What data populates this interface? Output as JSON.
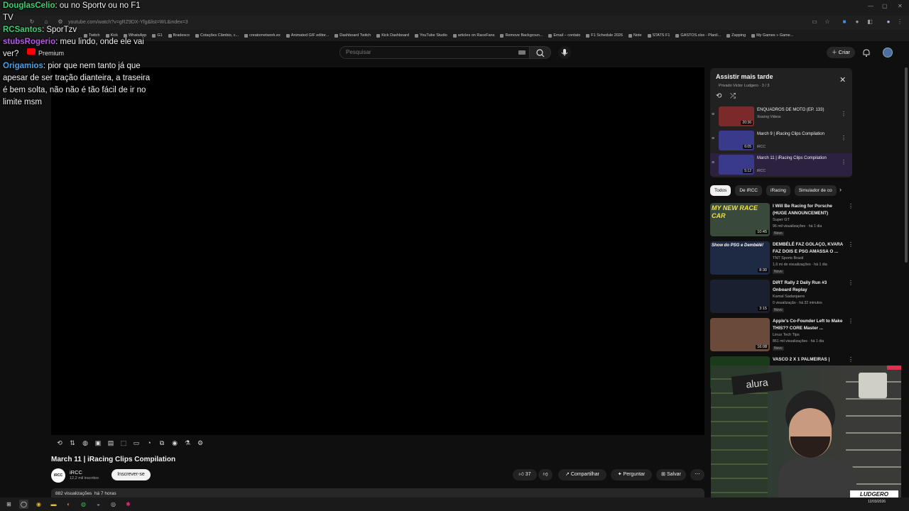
{
  "browser": {
    "url": "youtube.com/watch?v=gRZ9DX-Yfg&list=WL&index=3",
    "bookmarks": [
      "Twitch",
      "Kick",
      "WhatsApp",
      "G1",
      "Bradesco",
      "Cotações Câmbio, c...",
      "creatornetwork.ex",
      "Animated GIF editor...",
      "Dashboard Twitch",
      "Kick Dashboard",
      "YouTube Studio",
      "articles on RaceFans",
      "Remove Backgroun...",
      "Email – contato",
      "F1 Schedule 2026",
      "Note",
      "STATS F1",
      "GASTOS.xlsx - Planil...",
      "Zapping",
      "My Games » Game..."
    ]
  },
  "header": {
    "premium": "Premium",
    "search_placeholder": "Pesquisar",
    "create_label": "Criar"
  },
  "video": {
    "title": "March 11 | iRacing Clips Compilation",
    "channel": "iRCC",
    "channel_logo": "iRCC",
    "subscribers": "12,2 mil inscritos",
    "subscribe_label": "Inscrever-se",
    "likes": "37",
    "share_label": "Compartilhar",
    "ask_label": "Perguntar",
    "save_label": "Salvar",
    "views": "882 visualizações",
    "age": "há 7 horas"
  },
  "playlist": {
    "title": "Assistir mais tarde",
    "subtitle": "Privado  Victor Ludgero · 3 / 3",
    "items": [
      {
        "title": "ENQUADROS DE MOTO (EP. 133)",
        "channel": "Xracing Videos",
        "duration": "20:36",
        "color": "#7a2a2a"
      },
      {
        "title": "March 9 | iRacing Clips Compilation",
        "channel": "iRCC",
        "duration": "6:05",
        "color": "#3a3a8a"
      },
      {
        "title": "March 11 | iRacing Clips Compilation",
        "channel": "iRCC",
        "duration": "5:12",
        "color": "#3a3a8a"
      }
    ]
  },
  "chips": [
    "Todos",
    "De iRCC",
    "iRacing",
    "Simulador de co"
  ],
  "recommendations": [
    {
      "title": "I Will Be Racing for Porsche (HUGE ANNOUNCEMENT)",
      "channel": "Super GT",
      "meta": "96 mil visualizações · há 1 dia",
      "badge": "Novo",
      "duration": "10:45",
      "thumb_text": "MY NEW RACE CAR",
      "color": "#3a4a3a"
    },
    {
      "title": "DEMBÉLÉ FAZ GOLAÇO, KVARA FAZ DOIS E PSG AMASSA O ...",
      "channel": "TNT Sports Brasil",
      "meta": "1,6 mi de visualizações · há 1 dia",
      "badge": "Novo",
      "duration": "8:30",
      "thumb_text": "Show do PSG e Dembélé!",
      "color": "#1e2a44"
    },
    {
      "title": "DiRT Rally 2 Daily Run #3 Onboard Replay",
      "channel": "Kamal Sadanjaere",
      "meta": "0 visualização · há 32 minutos",
      "badge": "Novo",
      "duration": "3:15",
      "thumb_text": "",
      "color": "#1a2030"
    },
    {
      "title": "Apple's Co-Founder Left to Make THIS?? CORE Master ...",
      "channel": "Linus Tech Tips",
      "meta": "861 mil visualizações · há 1 dia",
      "badge": "Novo",
      "duration": "16:08",
      "thumb_text": "",
      "color": "#6a4a3a"
    },
    {
      "title": "VASCO 2 X 1 PALMEIRAS |",
      "channel": "",
      "meta": "",
      "badge": "",
      "duration": "",
      "thumb_text": "",
      "color": "#1a3a1a"
    }
  ],
  "chat": [
    {
      "name": "DouglasCelio",
      "color": "#3cd070",
      "text": ": ou no Sportv ou no F1 TV"
    },
    {
      "name": "RCSantos",
      "color": "#3cd070",
      "text": ": SporTzv"
    },
    {
      "name": "stubsRogerio",
      "color": "#b05ae0",
      "text": ": meu lindo, onde ele vai ver?"
    },
    {
      "name": "Origamios",
      "color": "#4aa0e8",
      "text": ": pior que nem tanto já que apesar de ser tração dianteira, a traseira é bem solta, não não é tão fácil de ir no limite msm"
    }
  ],
  "webcam": {
    "brand": "alura",
    "overlay": "LUDGERO"
  },
  "clock": {
    "time": "",
    "date": "12/03/2026"
  },
  "colors": {
    "accent": "#ff0000",
    "bg": "#0f0f0f"
  }
}
